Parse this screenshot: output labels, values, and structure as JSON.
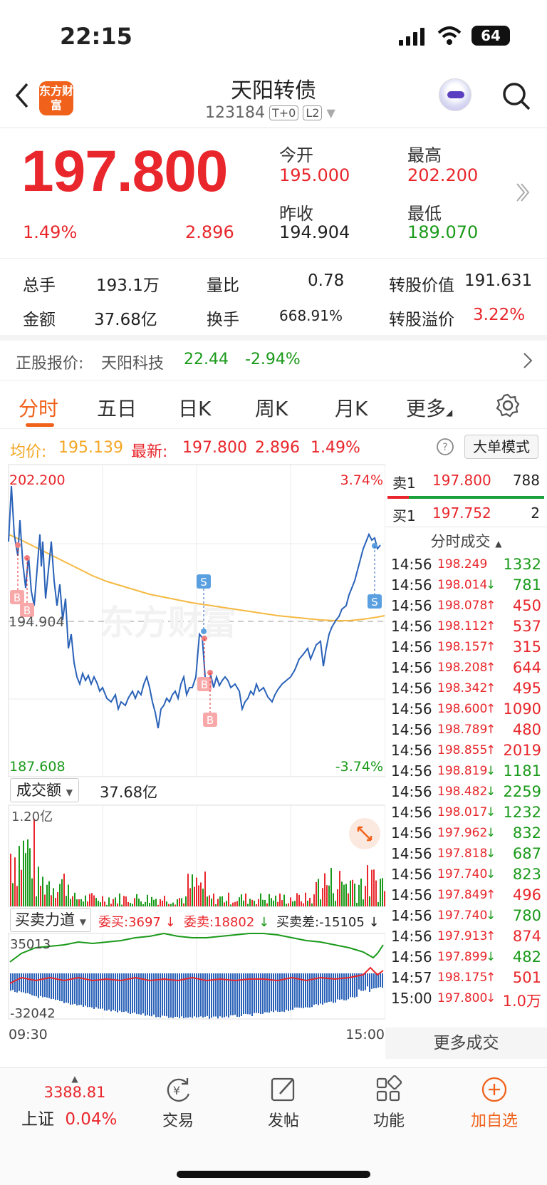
{
  "status_bar": {
    "time": "22:15",
    "battery": "64"
  },
  "nav": {
    "logo_text": "东方财富",
    "title": "天阳转债",
    "code": "123184",
    "tag1": "T+0",
    "tag2": "L2",
    "icons": [
      "back-icon",
      "robot-avatar-icon",
      "search-icon"
    ]
  },
  "quote": {
    "price": "197.800",
    "change_pct": "1.49%",
    "change": "2.896",
    "open_label": "今开",
    "open": "195.000",
    "high_label": "最高",
    "high": "202.200",
    "prev_close_label": "昨收",
    "prev_close": "194.904",
    "low_label": "最低",
    "low": "189.070"
  },
  "stats": {
    "volume_label": "总手",
    "volume": "193.1万",
    "ratio_label": "量比",
    "ratio": "0.78",
    "conv_value_label": "转股价值",
    "conv_value": "191.631",
    "amount_label": "金额",
    "amount": "37.68亿",
    "turnover_label": "换手",
    "turnover": "668.91%",
    "premium_label": "转股溢价",
    "premium": "3.22%"
  },
  "stock_row": {
    "label": "正股报价:",
    "name": "天阳科技",
    "price": "22.44",
    "change": "-2.94%"
  },
  "tabs": [
    "分时",
    "五日",
    "日K",
    "周K",
    "月K",
    "更多"
  ],
  "info_line": {
    "avg_label": "均价:",
    "avg": "195.139",
    "latest_label": "最新:",
    "latest": "197.800",
    "change": "2.896",
    "pct": "1.49%",
    "mode_button": "大单模式"
  },
  "chart": {
    "top_price": "202.200",
    "top_pct": "3.74%",
    "mid_price": "194.904",
    "bottom_price": "187.608",
    "bottom_pct": "-3.74%",
    "marker_b": "B",
    "marker_s": "S",
    "watermark": "东方财富",
    "volume_selector": "成交额",
    "volume_total": "37.68亿",
    "volume_max": "1.20亿",
    "force_selector": "买卖力道",
    "bid_label": "委买:3697",
    "ask_label": "委卖:18802",
    "diff_label": "买卖差:-15105",
    "force_max": "35013",
    "force_min": "-32042",
    "time_start": "09:30",
    "time_end": "15:00"
  },
  "order_book": {
    "sell1_label": "卖1",
    "sell1_price": "197.800",
    "sell1_vol": "788",
    "buy1_label": "买1",
    "buy1_price": "197.752",
    "buy1_vol": "2"
  },
  "trades_header": "分时成交",
  "trades": [
    {
      "t": "14:56",
      "p": "198.249",
      "d": "",
      "v": "1332",
      "c": "green"
    },
    {
      "t": "14:56",
      "p": "198.014",
      "d": "↓",
      "v": "781",
      "c": "green"
    },
    {
      "t": "14:56",
      "p": "198.078",
      "d": "↑",
      "v": "450",
      "c": "red"
    },
    {
      "t": "14:56",
      "p": "198.112",
      "d": "↑",
      "v": "537",
      "c": "red"
    },
    {
      "t": "14:56",
      "p": "198.157",
      "d": "↑",
      "v": "315",
      "c": "red"
    },
    {
      "t": "14:56",
      "p": "198.208",
      "d": "↑",
      "v": "644",
      "c": "red"
    },
    {
      "t": "14:56",
      "p": "198.342",
      "d": "↑",
      "v": "495",
      "c": "red"
    },
    {
      "t": "14:56",
      "p": "198.600",
      "d": "↑",
      "v": "1090",
      "c": "red"
    },
    {
      "t": "14:56",
      "p": "198.789",
      "d": "↑",
      "v": "480",
      "c": "red"
    },
    {
      "t": "14:56",
      "p": "198.855",
      "d": "↑",
      "v": "2019",
      "c": "red"
    },
    {
      "t": "14:56",
      "p": "198.819",
      "d": "↓",
      "v": "1181",
      "c": "green"
    },
    {
      "t": "14:56",
      "p": "198.482",
      "d": "↓",
      "v": "2259",
      "c": "green"
    },
    {
      "t": "14:56",
      "p": "198.017",
      "d": "↓",
      "v": "1232",
      "c": "green"
    },
    {
      "t": "14:56",
      "p": "197.962",
      "d": "↓",
      "v": "832",
      "c": "green"
    },
    {
      "t": "14:56",
      "p": "197.818",
      "d": "↓",
      "v": "687",
      "c": "green"
    },
    {
      "t": "14:56",
      "p": "197.740",
      "d": "↓",
      "v": "823",
      "c": "green"
    },
    {
      "t": "14:56",
      "p": "197.849",
      "d": "↑",
      "v": "496",
      "c": "red"
    },
    {
      "t": "14:56",
      "p": "197.740",
      "d": "↓",
      "v": "780",
      "c": "green"
    },
    {
      "t": "14:56",
      "p": "197.913",
      "d": "↑",
      "v": "874",
      "c": "red"
    },
    {
      "t": "14:56",
      "p": "197.899",
      "d": "↓",
      "v": "482",
      "c": "green"
    },
    {
      "t": "14:57",
      "p": "198.175",
      "d": "↑",
      "v": "501",
      "c": "red"
    },
    {
      "t": "15:00",
      "p": "197.800",
      "d": "↓",
      "v": "1.0万",
      "c": "red"
    }
  ],
  "more_trades": "更多成交",
  "bottom_bar": {
    "index_value": "3388.81",
    "index_name": "上证",
    "index_pct": "0.04%",
    "trade": "交易",
    "post": "发帖",
    "features": "功能",
    "watchlist": "加自选"
  },
  "colors": {
    "up": "#e8262b",
    "down": "#1a9a1a",
    "accent": "#f0621b",
    "avg_line": "#f5b942",
    "price_line": "#2a62b8"
  }
}
